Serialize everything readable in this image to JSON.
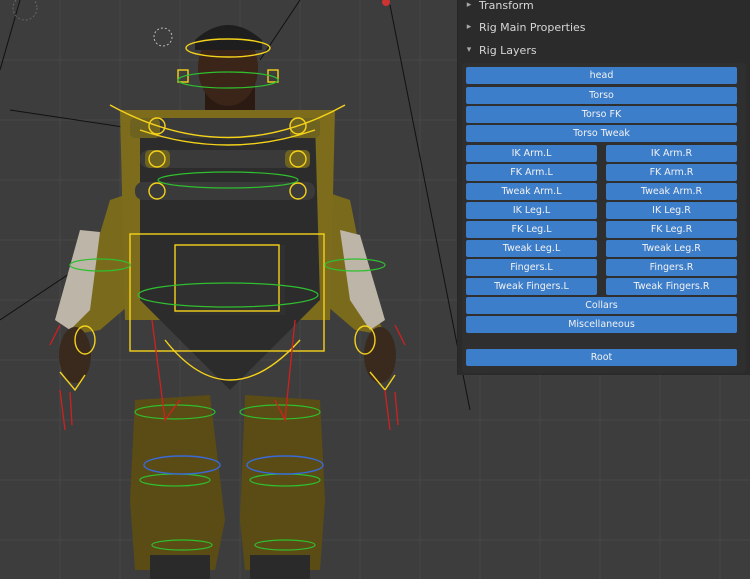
{
  "panels": {
    "transform": "Transform",
    "rig_main_properties": "Rig Main Properties",
    "rig_layers": "Rig Layers"
  },
  "layers": {
    "head": "head",
    "torso": "Torso",
    "torso_fk": "Torso FK",
    "torso_tweak": "Torso Tweak",
    "ik_arm_l": "IK Arm.L",
    "ik_arm_r": "IK Arm.R",
    "fk_arm_l": "FK Arm.L",
    "fk_arm_r": "FK Arm.R",
    "tweak_arm_l": "Tweak Arm.L",
    "tweak_arm_r": "Tweak Arm.R",
    "ik_leg_l": "IK Leg.L",
    "ik_leg_r": "IK Leg.R",
    "fk_leg_l": "FK Leg.L",
    "fk_leg_r": "FK Leg.R",
    "tweak_leg_l": "Tweak Leg.L",
    "tweak_leg_r": "Tweak Leg.R",
    "fingers_l": "Fingers.L",
    "fingers_r": "Fingers.R",
    "tweak_fingers_l": "Tweak Fingers.L",
    "tweak_fingers_r": "Tweak Fingers.R",
    "collars": "Collars",
    "miscellaneous": "Miscellaneous",
    "root": "Root"
  },
  "colors": {
    "layer_button": "#3d7ecb",
    "panel_bg": "#2b2b2b",
    "viewport_bg": "#3d3d3d",
    "rig_yellow": "#f5d21a",
    "rig_green": "#2fbf2f",
    "rig_red": "#d02020",
    "rig_blue": "#3a6ad8"
  }
}
